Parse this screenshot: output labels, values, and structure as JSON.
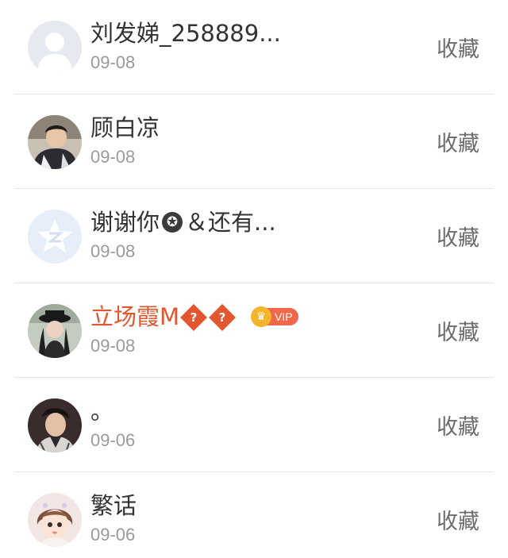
{
  "items": [
    {
      "name": "刘发娣_258889...",
      "date": "09-08",
      "action": "收藏"
    },
    {
      "name": "顾白凉",
      "date": "09-08",
      "action": "收藏"
    },
    {
      "name_prefix": "谢谢你",
      "name_star_icon": "✪",
      "name_suffix": "＆还有...",
      "date": "09-08",
      "action": "收藏"
    },
    {
      "name_prefix": "立场霞M",
      "name_q1": "?",
      "name_q2": "?",
      "vip_label": "VIP",
      "date": "09-08",
      "action": "收藏"
    },
    {
      "name": "。",
      "date": "09-06",
      "action": "收藏"
    },
    {
      "name": "繁话",
      "date": "09-06",
      "action": "收藏"
    }
  ],
  "colors": {
    "vip_name": "#e2572f",
    "date": "#9a9a9a",
    "action": "#6c6c6c",
    "divider": "#e4e4e4"
  }
}
